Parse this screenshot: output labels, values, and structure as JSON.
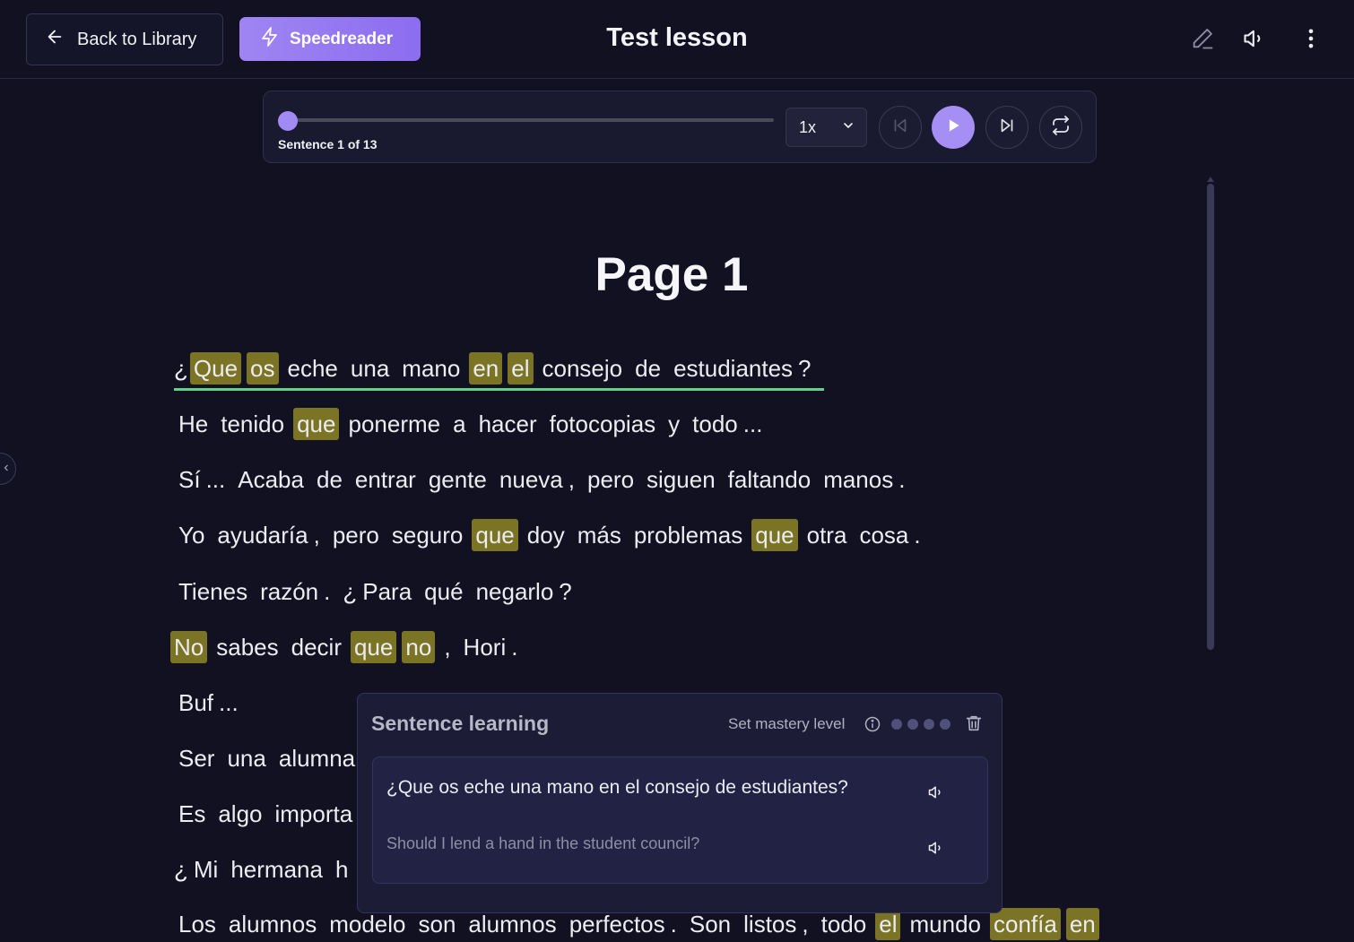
{
  "header": {
    "back_label": "Back to Library",
    "speedreader_label": "Speedreader",
    "title": "Test lesson"
  },
  "player": {
    "sentence_label": "Sentence 1 of 13",
    "speed": "1x",
    "progress": 0
  },
  "content": {
    "page_title": "Page 1",
    "lines": [
      [
        [
          "¿",
          0,
          1
        ],
        [
          "Que",
          1,
          0
        ],
        [
          "os",
          1,
          0
        ],
        [
          "eche",
          0,
          0
        ],
        [
          "una",
          0,
          0
        ],
        [
          "mano",
          0,
          0
        ],
        [
          "en",
          1,
          0
        ],
        [
          "el",
          1,
          0
        ],
        [
          "consejo",
          0,
          0
        ],
        [
          "de",
          0,
          0
        ],
        [
          "estudiantes",
          0,
          1
        ],
        [
          "?",
          0,
          0
        ]
      ],
      [
        [
          "He",
          0,
          0
        ],
        [
          "tenido",
          0,
          0
        ],
        [
          "que",
          1,
          0
        ],
        [
          "ponerme",
          0,
          0
        ],
        [
          "a",
          0,
          0
        ],
        [
          "hacer",
          0,
          0
        ],
        [
          "fotocopias",
          0,
          0
        ],
        [
          "y",
          0,
          0
        ],
        [
          "todo",
          0,
          1
        ],
        [
          "...",
          0,
          0
        ]
      ],
      [
        [
          "Sí",
          0,
          1
        ],
        [
          "...",
          0,
          0
        ],
        [
          "Acaba",
          0,
          0
        ],
        [
          "de",
          0,
          0
        ],
        [
          "entrar",
          0,
          0
        ],
        [
          "gente",
          0,
          0
        ],
        [
          "nueva",
          0,
          1
        ],
        [
          ",",
          0,
          0
        ],
        [
          "pero",
          0,
          0
        ],
        [
          "siguen",
          0,
          0
        ],
        [
          "faltando",
          0,
          0
        ],
        [
          "manos",
          0,
          1
        ],
        [
          ".",
          0,
          0
        ]
      ],
      [
        [
          "Yo",
          0,
          0
        ],
        [
          "ayudaría",
          0,
          1
        ],
        [
          ",",
          0,
          0
        ],
        [
          "pero",
          0,
          0
        ],
        [
          "seguro",
          0,
          0
        ],
        [
          "que",
          1,
          0
        ],
        [
          "doy",
          0,
          0
        ],
        [
          "más",
          0,
          0
        ],
        [
          "problemas",
          0,
          0
        ],
        [
          "que",
          1,
          0
        ],
        [
          "otra",
          0,
          0
        ],
        [
          "cosa",
          0,
          1
        ],
        [
          ".",
          0,
          0
        ]
      ],
      [
        [
          "Tienes",
          0,
          0
        ],
        [
          "razón",
          0,
          1
        ],
        [
          ".",
          0,
          0
        ],
        [
          "¿",
          0,
          1
        ],
        [
          "Para",
          0,
          0
        ],
        [
          "qué",
          0,
          0
        ],
        [
          "negarlo",
          0,
          1
        ],
        [
          "?",
          0,
          0
        ]
      ],
      [
        [
          "No",
          1,
          0
        ],
        [
          "sabes",
          0,
          0
        ],
        [
          "decir",
          0,
          0
        ],
        [
          "que",
          1,
          0
        ],
        [
          "no",
          1,
          0
        ],
        [
          ",",
          0,
          0
        ],
        [
          "Hori",
          0,
          1
        ],
        [
          ".",
          0,
          0
        ]
      ],
      [
        [
          "Buf",
          0,
          1
        ],
        [
          "...",
          0,
          0
        ]
      ],
      [
        [
          "Ser",
          0,
          0
        ],
        [
          "una",
          0,
          0
        ],
        [
          "alumna",
          0,
          0
        ]
      ],
      [
        [
          "Es",
          0,
          0
        ],
        [
          "algo",
          0,
          0
        ],
        [
          "importa",
          0,
          0
        ]
      ],
      [
        [
          "¿",
          0,
          1
        ],
        [
          "Mi",
          0,
          0
        ],
        [
          "hermana",
          0,
          0
        ],
        [
          "h",
          0,
          0
        ]
      ],
      [
        [
          "Los",
          0,
          0
        ],
        [
          "alumnos",
          0,
          0
        ],
        [
          "modelo",
          0,
          0
        ],
        [
          "son",
          0,
          0
        ],
        [
          "alumnos",
          0,
          0
        ],
        [
          "perfectos",
          0,
          1
        ],
        [
          ".",
          0,
          0
        ],
        [
          "Son",
          0,
          0
        ],
        [
          "listos",
          0,
          1
        ],
        [
          ",",
          0,
          0
        ],
        [
          "todo",
          0,
          0
        ],
        [
          "el",
          1,
          0
        ],
        [
          "mundo",
          0,
          0
        ],
        [
          "confía",
          1,
          0
        ],
        [
          "en",
          1,
          0
        ]
      ]
    ]
  },
  "popup": {
    "title": "Sentence learning",
    "mastery_label": "Set mastery level",
    "original": "¿Que os eche una mano en el consejo de estudiantes?",
    "translation": "Should I lend a hand in the student council?",
    "mastery_levels": 4,
    "mastery_current": 0
  },
  "colors": {
    "accent": "#a18af3",
    "highlight": "#7a7424",
    "active_underline": "#61d28b",
    "background": "#111121"
  }
}
